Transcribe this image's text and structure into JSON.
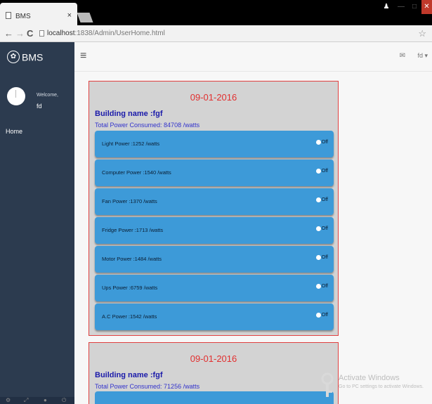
{
  "browser": {
    "tab_title": "BMS",
    "tab_close": "×",
    "url_host": "localhost",
    "url_path": ":1838/Admin/UserHome.html"
  },
  "sidebar": {
    "brand": "BMS",
    "welcome": "Welcome,",
    "username": "fd",
    "home": "Home"
  },
  "header": {
    "menu_icon": "≡",
    "user_menu": "fd ▾"
  },
  "buildings": [
    {
      "date": "09-01-2016",
      "building_name": "Building name :fgf",
      "total_power": "Total Power Consumed: 84708 /watts",
      "devices": [
        {
          "label": "Light Power :1252 /watts",
          "state": "Off"
        },
        {
          "label": "Computer Power :1540 /watts",
          "state": "Off"
        },
        {
          "label": "Fan Power :1370 /watts",
          "state": "Off"
        },
        {
          "label": "Fridge Power :1713 /watts",
          "state": "Off"
        },
        {
          "label": "Motor Power :1484 /watts",
          "state": "Off"
        },
        {
          "label": "Ups Power :6759 /watts",
          "state": "Off"
        },
        {
          "label": "A.C Power :1542 /watts",
          "state": "Off"
        }
      ]
    },
    {
      "date": "09-01-2016",
      "building_name": "Building name :fgf",
      "total_power": "Total Power Consumed: 71256 /watts"
    }
  ],
  "watermark": {
    "title": "Activate Windows",
    "subtitle": "Go to PC settings to activate Windows."
  },
  "colors": {
    "sidebar_bg": "#2c3b4f",
    "device_bar": "#3d9ad8",
    "card_border": "#e04040",
    "date_text": "#e23030",
    "building_text": "#1a1aaa"
  }
}
